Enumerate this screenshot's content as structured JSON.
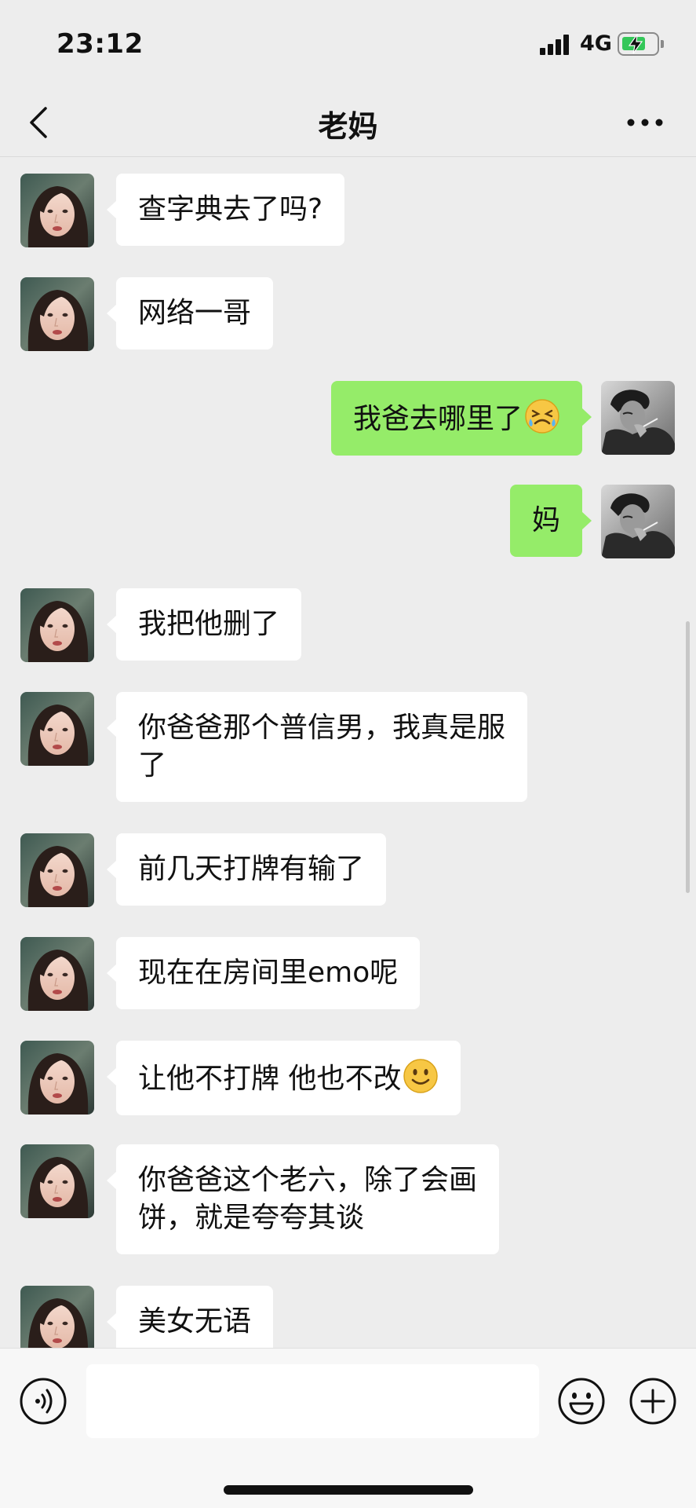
{
  "status_bar": {
    "time": "23:12",
    "network": "4G",
    "battery_level": 0.65,
    "battery_charging": true,
    "signal_icon": "signal-bars-icon",
    "battery_icon": "battery-charging-icon"
  },
  "nav": {
    "title": "老妈",
    "back_icon": "chevron-left-icon",
    "more_icon": "more-dots-icon"
  },
  "colors": {
    "background": "#ededed",
    "incoming_bubble": "#ffffff",
    "outgoing_bubble": "#95ec69",
    "battery_green": "#34c759"
  },
  "messages": [
    {
      "from": "mom",
      "text": "查字典去了吗?"
    },
    {
      "from": "mom",
      "text": "网络一哥"
    },
    {
      "from": "me",
      "text": "我爸去哪里了",
      "emoji": "crying-face-emoji"
    },
    {
      "from": "me",
      "text": "妈"
    },
    {
      "from": "mom",
      "text": "我把他删了"
    },
    {
      "from": "mom",
      "line1": "你爸爸那个普信男，我真是服",
      "line2": "了"
    },
    {
      "from": "mom",
      "text": "前几天打牌有输了"
    },
    {
      "from": "mom",
      "text": "现在在房间里emo呢"
    },
    {
      "from": "mom",
      "text": "让他不打牌 他也不改",
      "emoji": "smiling-face-emoji"
    },
    {
      "from": "mom",
      "line1": "你爸爸这个老六，除了会画",
      "line2": "饼，就是夸夸其谈"
    },
    {
      "from": "mom",
      "text": "美女无语"
    }
  ],
  "input_bar": {
    "text_value": "",
    "voice_icon": "voice-icon",
    "emoji_icon": "emoji-face-icon",
    "plus_icon": "plus-circle-icon"
  }
}
